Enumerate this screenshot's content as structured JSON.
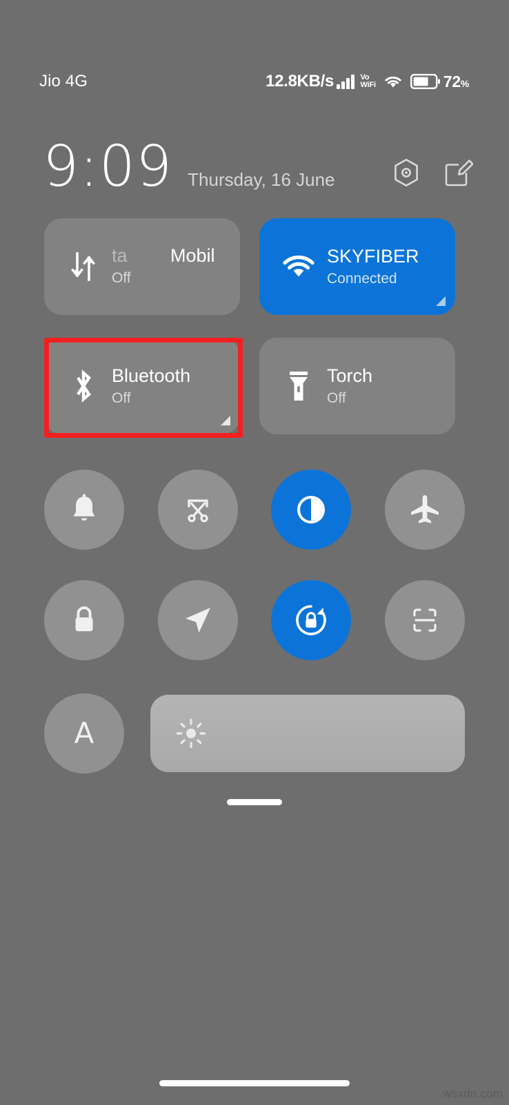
{
  "status_bar": {
    "carrier": "Jio 4G",
    "network_speed": "12.8KB/s",
    "signal_icon": "signal-bars-icon",
    "volte_line1": "Vo",
    "volte_line2": "WiFi",
    "wifi_icon": "wifi-icon",
    "battery_icon": "battery-icon",
    "battery_percent": "72",
    "battery_percent_symbol": "%"
  },
  "header": {
    "time": "9:09",
    "date": "Thursday, 16 June",
    "settings_icon": "settings-hexagon-icon",
    "edit_icon": "edit-tiles-icon"
  },
  "tiles": [
    {
      "name": "mobile-data",
      "icon": "mobile-data-icon",
      "title_ghost": "ta",
      "title_incoming": "Mobil",
      "subtitle": "Off",
      "active": false,
      "expandable": false
    },
    {
      "name": "wifi",
      "icon": "wifi-icon",
      "title": "SKYFIBER",
      "subtitle": "Connected",
      "active": true,
      "expandable": true
    },
    {
      "name": "bluetooth",
      "icon": "bluetooth-icon",
      "title": "Bluetooth",
      "subtitle": "Off",
      "active": false,
      "expandable": true,
      "highlighted": true
    },
    {
      "name": "torch",
      "icon": "torch-icon",
      "title": "Torch",
      "subtitle": "Off",
      "active": false,
      "expandable": false
    }
  ],
  "toggle_rows": [
    [
      {
        "name": "sound",
        "icon": "bell-icon",
        "active": false
      },
      {
        "name": "screenshot",
        "icon": "screenshot-scissors-icon",
        "active": false
      },
      {
        "name": "dark-mode",
        "icon": "dark-mode-contrast-icon",
        "active": true
      },
      {
        "name": "airplane-mode",
        "icon": "airplane-icon",
        "active": false
      }
    ],
    [
      {
        "name": "screen-lock",
        "icon": "lock-icon",
        "active": false
      },
      {
        "name": "location",
        "icon": "location-arrow-icon",
        "active": false
      },
      {
        "name": "auto-rotate-lock",
        "icon": "rotation-lock-icon",
        "active": true
      },
      {
        "name": "scanner",
        "icon": "scan-frame-icon",
        "active": false
      }
    ]
  ],
  "brightness": {
    "auto_label": "A",
    "auto_active": false,
    "slider_icon": "brightness-sun-icon",
    "level_percent": 100
  },
  "footer": {
    "drag_handle": "panel-drag-handle",
    "home_bar": "home-gesture-bar",
    "watermark": "wsxdn.com"
  },
  "colors": {
    "background": "#6e6e6e",
    "tile_inactive": "#828282",
    "tile_active": "#0c74d8",
    "circle_inactive": "#919191",
    "slider_fill": "#adadad",
    "annotation": "#f42020",
    "text_primary": "#ffffff",
    "text_secondary": "#d9d9d9"
  }
}
